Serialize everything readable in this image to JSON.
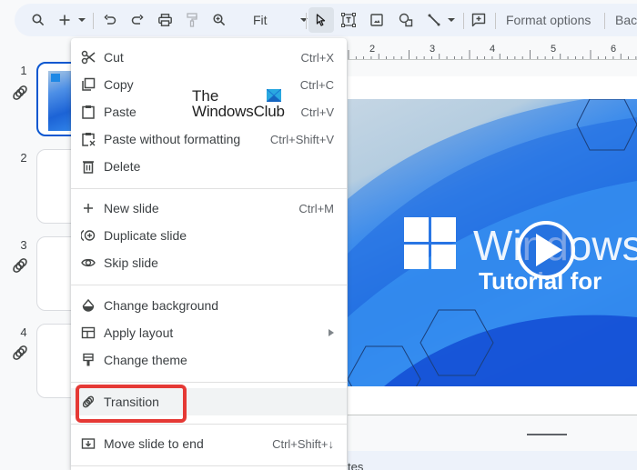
{
  "toolbar": {
    "zoom_value": "Fit",
    "format_options_label": "Format options",
    "background_label": "Bac",
    "icons": [
      "search-icon",
      "add-icon",
      "dropdown-icon",
      "undo-icon",
      "redo-icon",
      "print-icon",
      "paint-format-icon",
      "zoom-icon",
      "select-icon",
      "textbox-icon",
      "image-icon",
      "shape-icon",
      "line-icon",
      "comment-icon"
    ]
  },
  "filmstrip": {
    "slides": [
      {
        "number": "1",
        "has_transition": true,
        "selected": true
      },
      {
        "number": "2",
        "has_transition": false,
        "selected": false
      },
      {
        "number": "3",
        "has_transition": true,
        "selected": false
      },
      {
        "number": "4",
        "has_transition": true,
        "selected": false
      }
    ]
  },
  "ruler": {
    "numbers": [
      "2",
      "3",
      "4",
      "5",
      "6"
    ]
  },
  "slide": {
    "title_text": "Windows",
    "subtitle_text": "Tutorial for"
  },
  "watermark": {
    "line1": "The",
    "line2": "WindowsClub"
  },
  "context_menu": {
    "groups": [
      [
        {
          "label": "Cut",
          "shortcut": "Ctrl+X",
          "icon": "scissors-icon"
        },
        {
          "label": "Copy",
          "shortcut": "Ctrl+C",
          "icon": "copy-icon"
        },
        {
          "label": "Paste",
          "shortcut": "Ctrl+V",
          "icon": "paste-icon"
        },
        {
          "label": "Paste without formatting",
          "shortcut": "Ctrl+Shift+V",
          "icon": "paste-plain-icon"
        },
        {
          "label": "Delete",
          "shortcut": "",
          "icon": "trash-icon"
        }
      ],
      [
        {
          "label": "New slide",
          "shortcut": "Ctrl+M",
          "icon": "plus-icon"
        },
        {
          "label": "Duplicate slide",
          "shortcut": "",
          "icon": "duplicate-icon"
        },
        {
          "label": "Skip slide",
          "shortcut": "",
          "icon": "eye-icon"
        }
      ],
      [
        {
          "label": "Change background",
          "shortcut": "",
          "icon": "fill-icon"
        },
        {
          "label": "Apply layout",
          "shortcut": "",
          "icon": "layout-icon",
          "submenu": true
        },
        {
          "label": "Change theme",
          "shortcut": "",
          "icon": "theme-brush-icon"
        }
      ],
      [
        {
          "label": "Transition",
          "shortcut": "",
          "icon": "transition-icon",
          "highlighted": true
        }
      ],
      [
        {
          "label": "Move slide to end",
          "shortcut": "Ctrl+Shift+↓",
          "icon": "move-to-end-icon"
        }
      ]
    ]
  },
  "bottom": {
    "notes_partial": "tes"
  },
  "colors": {
    "accent": "#0b57d0",
    "highlight_box": "#e53935",
    "toolbar_bg": "#edf2fa"
  }
}
